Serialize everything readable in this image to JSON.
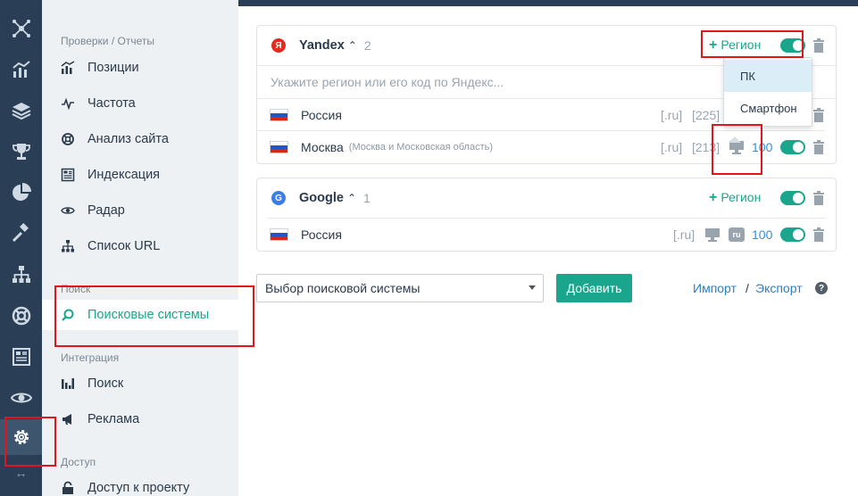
{
  "sidebar": {
    "sections": {
      "reports": "Проверки / Отчеты",
      "search": "Поиск",
      "integration": "Интеграция",
      "access": "Доступ"
    },
    "items": [
      {
        "label": "Позиции",
        "icon": "bar-chart-icon"
      },
      {
        "label": "Частота",
        "icon": "pulse-icon"
      },
      {
        "label": "Анализ сайта",
        "icon": "lifebuoy-icon"
      },
      {
        "label": "Индексация",
        "icon": "newspaper-icon"
      },
      {
        "label": "Радар",
        "icon": "eye-icon"
      },
      {
        "label": "Список URL",
        "icon": "sitemap-icon"
      },
      {
        "label": "Поисковые системы",
        "icon": "search-icon"
      },
      {
        "label": "Поиск",
        "icon": "signal-bars-icon"
      },
      {
        "label": "Реклама",
        "icon": "megaphone-icon"
      },
      {
        "label": "Доступ к проекту",
        "icon": "lock-icon"
      }
    ]
  },
  "yandex": {
    "name": "Yandex",
    "count": "2",
    "add_region": "Регион",
    "placeholder": "Укажите регион или его код по Яндекс...",
    "rows": [
      {
        "region": "Россия",
        "sub": "",
        "domain": "[.ru]",
        "code": "[225]"
      },
      {
        "region": "Москва",
        "sub": "(Москва и Московская область)",
        "domain": "[.ru]",
        "code": "[213]",
        "num": "100"
      }
    ]
  },
  "google": {
    "name": "Google",
    "count": "1",
    "add_region": "Регион",
    "rows": [
      {
        "region": "Россия",
        "domain": "[.ru]",
        "badge": "ru",
        "num": "100"
      }
    ]
  },
  "device_popup": {
    "options": [
      "ПК",
      "Смартфон"
    ],
    "selected": "ПК"
  },
  "controls": {
    "select_label": "Выбор поисковой системы",
    "add_button": "Добавить",
    "import": "Импорт",
    "separator": "/",
    "export": "Экспорт",
    "help": "?"
  },
  "colors": {
    "accent": "#1aa68c",
    "sidebar_dark": "#2a3f55",
    "annotation": "#e0161c",
    "link": "#2a7fc9"
  }
}
